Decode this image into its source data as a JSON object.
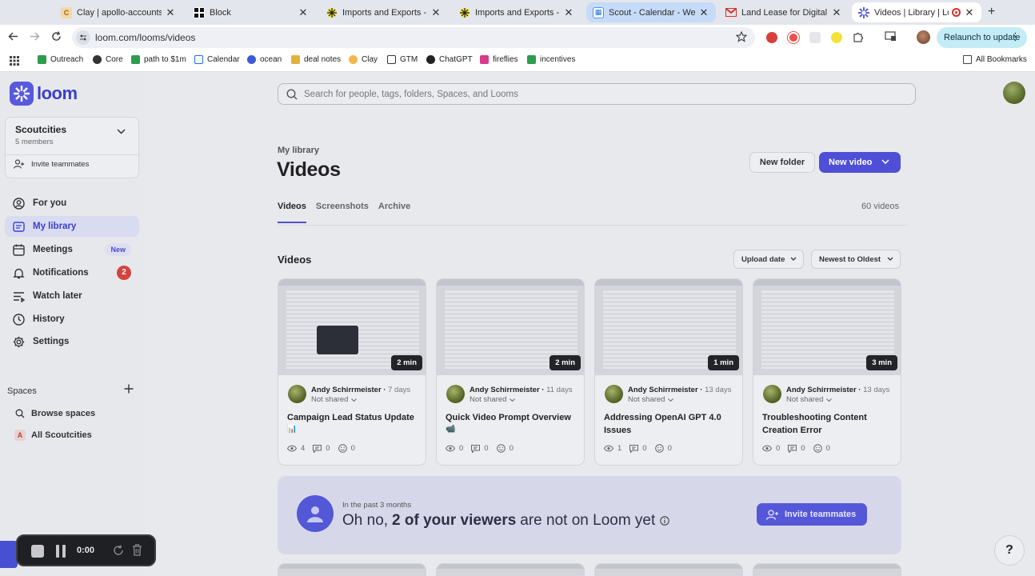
{
  "browser": {
    "tabs": [
      {
        "title": "Clay | apollo-accounts-exp",
        "favicon": "clay"
      },
      {
        "title": "Block",
        "favicon": "block"
      },
      {
        "title": "Imports and Exports - Apo",
        "favicon": "apollo"
      },
      {
        "title": "Imports and Exports - Apo",
        "favicon": "apollo"
      },
      {
        "title": "Scout - Calendar - Week o",
        "favicon": "calendar"
      },
      {
        "title": "Land Lease for Digital Infra",
        "favicon": "gmail"
      },
      {
        "title": "Videos | Library | Loom",
        "favicon": "loom"
      }
    ],
    "url": "loom.com/looms/videos",
    "relaunch_label": "Relaunch to update",
    "bookmarks": [
      {
        "label": "Outreach"
      },
      {
        "label": "Core"
      },
      {
        "label": "path to $1m"
      },
      {
        "label": "Calendar"
      },
      {
        "label": "ocean"
      },
      {
        "label": "deal notes"
      },
      {
        "label": "Clay"
      },
      {
        "label": "GTM"
      },
      {
        "label": "ChatGPT"
      },
      {
        "label": "fireflies"
      },
      {
        "label": "incentives"
      }
    ],
    "all_bookmarks": "All Bookmarks"
  },
  "sidebar": {
    "brand": "loom",
    "workspace": {
      "name": "Scoutcities",
      "members": "5 members",
      "invite": "Invite teammates"
    },
    "nav": [
      {
        "label": "For you",
        "icon": "user-circle-icon"
      },
      {
        "label": "My library",
        "icon": "library-icon"
      },
      {
        "label": "Meetings",
        "icon": "calendar-icon",
        "badge": "New"
      },
      {
        "label": "Notifications",
        "icon": "bell-icon",
        "count": "2"
      },
      {
        "label": "Watch later",
        "icon": "list-icon"
      },
      {
        "label": "History",
        "icon": "clock-icon"
      },
      {
        "label": "Settings",
        "icon": "gear-icon"
      }
    ],
    "spaces_heading": "Spaces",
    "spaces": [
      {
        "label": "Browse spaces"
      },
      {
        "label": "All Scoutcities",
        "letter": "A"
      }
    ]
  },
  "main": {
    "search_placeholder": "Search for people, tags, folders, Spaces, and Looms",
    "breadcrumb": "My library",
    "title": "Videos",
    "new_folder": "New folder",
    "new_video": "New video",
    "tabs": [
      "Videos",
      "Screenshots",
      "Archive"
    ],
    "count": "60 videos",
    "section_title": "Videos",
    "sort_field": "Upload date",
    "sort_order": "Newest to Oldest",
    "videos": [
      {
        "duration": "2 min",
        "author": "Andy Schirrmeister",
        "age": "7 days",
        "sharing": "Not shared",
        "title": "Campaign Lead Status Update",
        "emoji": "📊",
        "views": "4",
        "comments": "0",
        "reactions": "0"
      },
      {
        "duration": "2 min",
        "author": "Andy Schirrmeister",
        "age": "11 days",
        "sharing": "Not shared",
        "title": "Quick Video Prompt Overview",
        "emoji": "📹",
        "views": "0",
        "comments": "0",
        "reactions": "0"
      },
      {
        "duration": "1 min",
        "author": "Andy Schirrmeister",
        "age": "13 days",
        "sharing": "Not shared",
        "title": "Addressing OpenAI GPT 4.0 Issues",
        "emoji": "",
        "views": "1",
        "comments": "0",
        "reactions": "0"
      },
      {
        "duration": "3 min",
        "author": "Andy Schirrmeister",
        "age": "13 days",
        "sharing": "Not shared",
        "title": "Troubleshooting Content Creation Error",
        "emoji": "",
        "views": "0",
        "comments": "0",
        "reactions": "0"
      }
    ],
    "banner": {
      "period": "In the past 3 months",
      "text_pre": "Oh no,",
      "text_bold": "2 of your viewers",
      "text_post": "are not on Loom yet",
      "button": "Invite teammates"
    }
  },
  "recorder": {
    "time": "0:00"
  },
  "colors": {
    "accent": "#4e4fd6",
    "notification": "#d6433e"
  }
}
